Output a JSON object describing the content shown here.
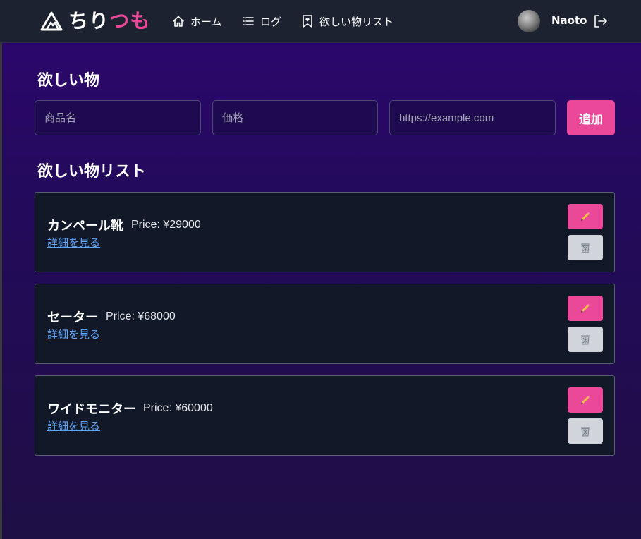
{
  "app": {
    "logo_part1": "ちり",
    "logo_part2": "つも"
  },
  "nav": {
    "home_label": "ホーム",
    "log_label": "ログ",
    "wishlist_label": "欲しい物リスト"
  },
  "user": {
    "name": "Naoto"
  },
  "form": {
    "title": "欲しい物",
    "name_placeholder": "商品名",
    "price_placeholder": "価格",
    "url_placeholder": "https://example.com",
    "add_label": "追加"
  },
  "list": {
    "title": "欲しい物リスト",
    "items": [
      {
        "name": "カンペール靴",
        "price": "Price: ¥29000",
        "link": "詳細を見る"
      },
      {
        "name": "セーター",
        "price": "Price: ¥68000",
        "link": "詳細を見る"
      },
      {
        "name": "ワイドモニター",
        "price": "Price: ¥60000",
        "link": "詳細を見る"
      }
    ]
  },
  "colors": {
    "accent": "#ec4899",
    "link": "#60a5fa",
    "card_bg": "#111827",
    "nav_bg": "#1c2230"
  },
  "icons": [
    "mountain-logo-icon",
    "home-icon",
    "list-icon",
    "bookmark-heart-icon",
    "logout-icon",
    "pencil-icon",
    "trash-icon"
  ]
}
